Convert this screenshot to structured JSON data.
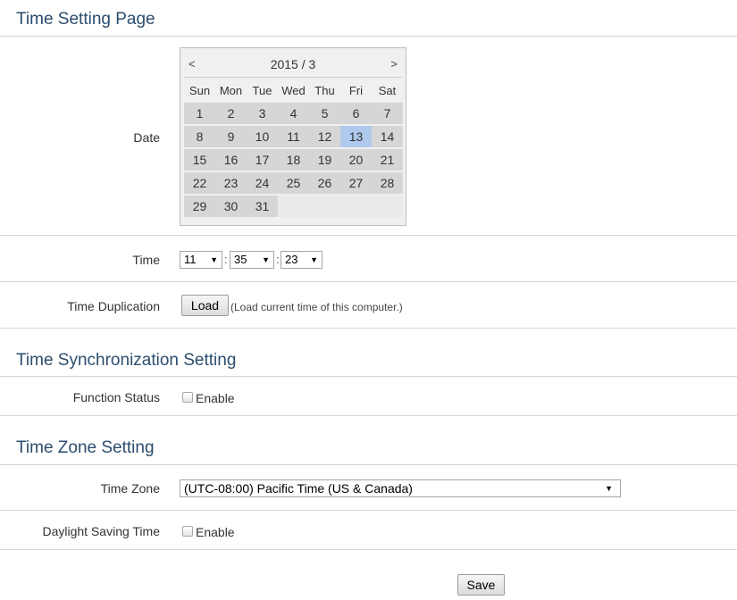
{
  "sections": {
    "time_setting": "Time Setting Page",
    "time_sync": "Time Synchronization Setting",
    "time_zone": "Time Zone Setting"
  },
  "labels": {
    "date": "Date",
    "time": "Time",
    "time_duplication": "Time Duplication",
    "function_status": "Function Status",
    "time_zone": "Time Zone",
    "daylight_saving": "Daylight Saving Time"
  },
  "calendar": {
    "prev": "<",
    "next": ">",
    "title": "2015 / 3",
    "weekdays": [
      "Sun",
      "Mon",
      "Tue",
      "Wed",
      "Thu",
      "Fri",
      "Sat"
    ],
    "weeks": [
      [
        "1",
        "2",
        "3",
        "4",
        "5",
        "6",
        "7"
      ],
      [
        "8",
        "9",
        "10",
        "11",
        "12",
        "13",
        "14"
      ],
      [
        "15",
        "16",
        "17",
        "18",
        "19",
        "20",
        "21"
      ],
      [
        "22",
        "23",
        "24",
        "25",
        "26",
        "27",
        "28"
      ],
      [
        "29",
        "30",
        "31",
        "",
        "",
        "",
        ""
      ]
    ],
    "selected": "13"
  },
  "time": {
    "hour": "11",
    "minute": "35",
    "second": "23",
    "separator": ":"
  },
  "duplication": {
    "button": "Load",
    "hint": "(Load current time of this computer.)"
  },
  "sync": {
    "enable_label": "Enable",
    "enabled": false
  },
  "zone": {
    "value": "(UTC-08:00) Pacific Time (US & Canada)"
  },
  "dst": {
    "enable_label": "Enable",
    "enabled": false
  },
  "save_label": "Save",
  "icons": {
    "dropdown": "▼"
  }
}
